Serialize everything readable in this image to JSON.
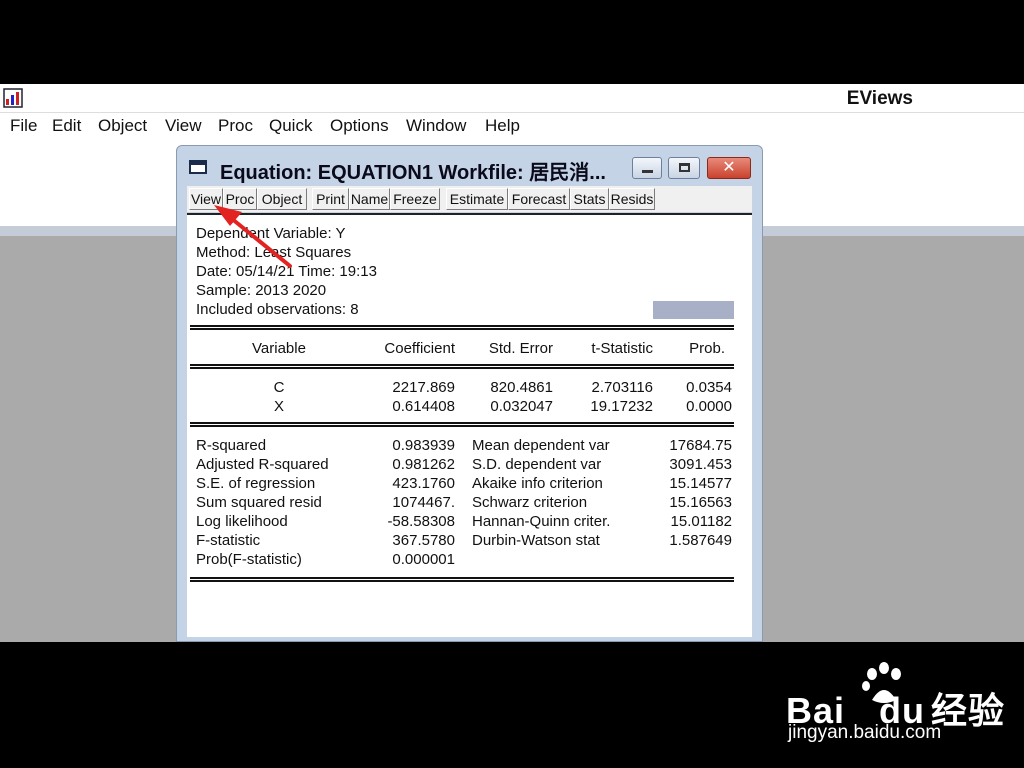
{
  "app": {
    "title": "EViews"
  },
  "menu": [
    "File",
    "Edit",
    "Object",
    "View",
    "Proc",
    "Quick",
    "Options",
    "Window",
    "Help"
  ],
  "equation_window": {
    "title": "Equation: EQUATION1   Workfile: 居民消...",
    "toolbar": [
      "View",
      "Proc",
      "Object",
      "Print",
      "Name",
      "Freeze",
      "Estimate",
      "Forecast",
      "Stats",
      "Resids"
    ],
    "header": {
      "dependent": "Dependent Variable: Y",
      "method": "Method: Least Squares",
      "date": "Date: 05/14/21   Time: 19:13",
      "sample": "Sample: 2013 2020",
      "observations": "Included observations: 8"
    },
    "columns": [
      "Variable",
      "Coefficient",
      "Std. Error",
      "t-Statistic",
      "Prob."
    ],
    "rows": [
      [
        "C",
        "2217.869",
        "820.4861",
        "2.703116",
        "0.0354"
      ],
      [
        "X",
        "0.614408",
        "0.032047",
        "19.17232",
        "0.0000"
      ]
    ],
    "stats_left": [
      [
        "R-squared",
        "0.983939"
      ],
      [
        "Adjusted R-squared",
        "0.981262"
      ],
      [
        "S.E. of regression",
        "423.1760"
      ],
      [
        "Sum squared resid",
        "1074467."
      ],
      [
        "Log likelihood",
        "-58.58308"
      ],
      [
        "F-statistic",
        "367.5780"
      ],
      [
        "Prob(F-statistic)",
        "0.000001"
      ]
    ],
    "stats_right": [
      [
        "Mean dependent var",
        "17684.75"
      ],
      [
        "S.D. dependent var",
        "3091.453"
      ],
      [
        "Akaike info criterion",
        "15.14577"
      ],
      [
        "Schwarz criterion",
        "15.16563"
      ],
      [
        "Hannan-Quinn criter.",
        "15.01182"
      ],
      [
        "Durbin-Watson stat",
        "1.587649"
      ]
    ]
  },
  "watermark": {
    "brand_a": "Bai",
    "brand_b": "du",
    "brand_cn": "经验",
    "url": "jingyan.baidu.com"
  }
}
